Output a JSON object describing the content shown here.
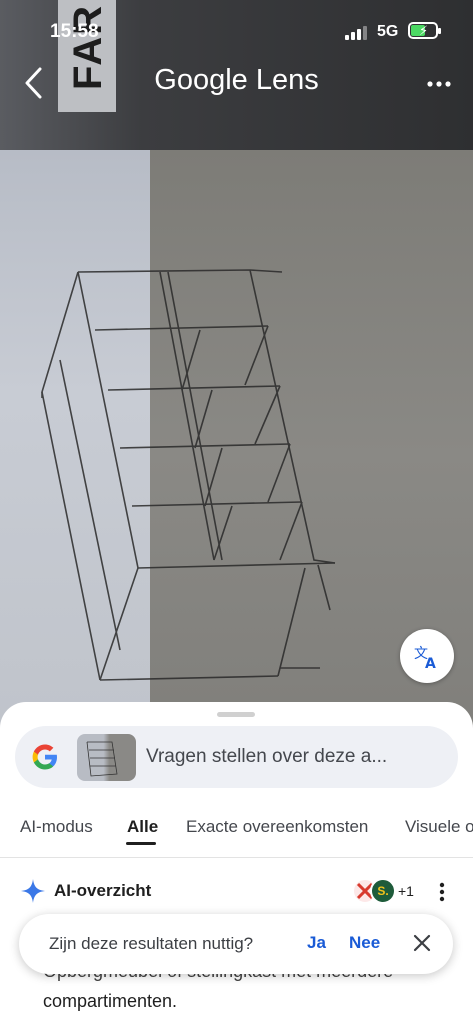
{
  "status_bar": {
    "time": "15:58",
    "network": "5G",
    "battery_charging": true
  },
  "nav": {
    "title": "Google Lens",
    "back_icon": "chevron-left-icon",
    "more_icon": "more-horizontal-icon"
  },
  "photo": {
    "overlay_text": "FAR"
  },
  "translate_button": {
    "icon": "translate-icon"
  },
  "search": {
    "placeholder": "Vragen stellen over deze a..."
  },
  "tabs": [
    {
      "label": "AI-modus",
      "active": false
    },
    {
      "label": "Alle",
      "active": true
    },
    {
      "label": "Exacte overeenkomsten",
      "active": false
    },
    {
      "label": "Visuele o",
      "active": false
    }
  ],
  "ai_overview": {
    "title": "AI-overzicht",
    "source_count": "+1",
    "body_line1": "Opbergmeubel of stellingkast met meerdere",
    "body_line2": "compartimenten."
  },
  "feedback": {
    "question": "Zijn deze resultaten nuttig?",
    "yes": "Ja",
    "no": "Nee"
  },
  "colors": {
    "accent_blue": "#1a5bd6",
    "sheet_bg": "#ffffff",
    "pill_bg": "#eef0f5"
  }
}
